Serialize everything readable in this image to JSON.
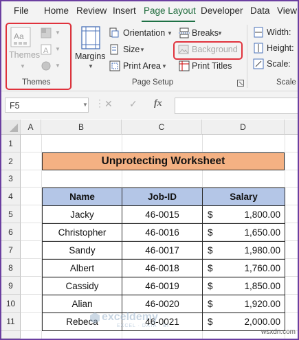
{
  "ribbon_tabs": [
    "File",
    "Home",
    "Review",
    "Insert",
    "Page Layout",
    "Developer",
    "Data",
    "View"
  ],
  "active_tab": "Page Layout",
  "themes_group": {
    "themes_label": "Themes",
    "group_label": "Themes"
  },
  "page_setup": {
    "margins": "Margins",
    "orientation": "Orientation",
    "size": "Size",
    "print_area": "Print Area",
    "breaks": "Breaks",
    "background": "Background",
    "print_titles": "Print Titles",
    "group_label": "Page Setup"
  },
  "scale_group": {
    "width": "Width:",
    "height": "Height:",
    "scale": "Scale:",
    "group_label": "Scale t"
  },
  "formula_bar": {
    "name_box": "F5",
    "fx": "fx",
    "formula": ""
  },
  "columns": [
    "A",
    "B",
    "C",
    "D"
  ],
  "rows": [
    "1",
    "2",
    "3",
    "4",
    "5",
    "6",
    "7",
    "8",
    "9",
    "10",
    "11"
  ],
  "sheet": {
    "title": "Unprotecting Worksheet",
    "headers": [
      "Name",
      "Job-ID",
      "Salary"
    ],
    "currency_symbol": "$",
    "records": [
      {
        "name": "Jacky",
        "job_id": "46-0015",
        "salary": "1,800.00"
      },
      {
        "name": "Christopher",
        "job_id": "46-0016",
        "salary": "1,650.00"
      },
      {
        "name": "Sandy",
        "job_id": "46-0017",
        "salary": "1,980.00"
      },
      {
        "name": "Albert",
        "job_id": "46-0018",
        "salary": "1,760.00"
      },
      {
        "name": "Cassidy",
        "job_id": "46-0019",
        "salary": "1,850.00"
      },
      {
        "name": "Alian",
        "job_id": "46-0020",
        "salary": "1,920.00"
      },
      {
        "name": "Rebeca",
        "job_id": "46-0021",
        "salary": "2,000.00"
      }
    ]
  },
  "watermark": {
    "brand": "exceldemy",
    "tagline": "EXCEL · DATA · BI"
  },
  "site": "wsxdn.com",
  "colors": {
    "accent": "#1e7145",
    "highlight": "#e0323c",
    "title_fill": "#f4b183",
    "header_fill": "#b4c6e7",
    "frame": "#6b3fa0"
  }
}
